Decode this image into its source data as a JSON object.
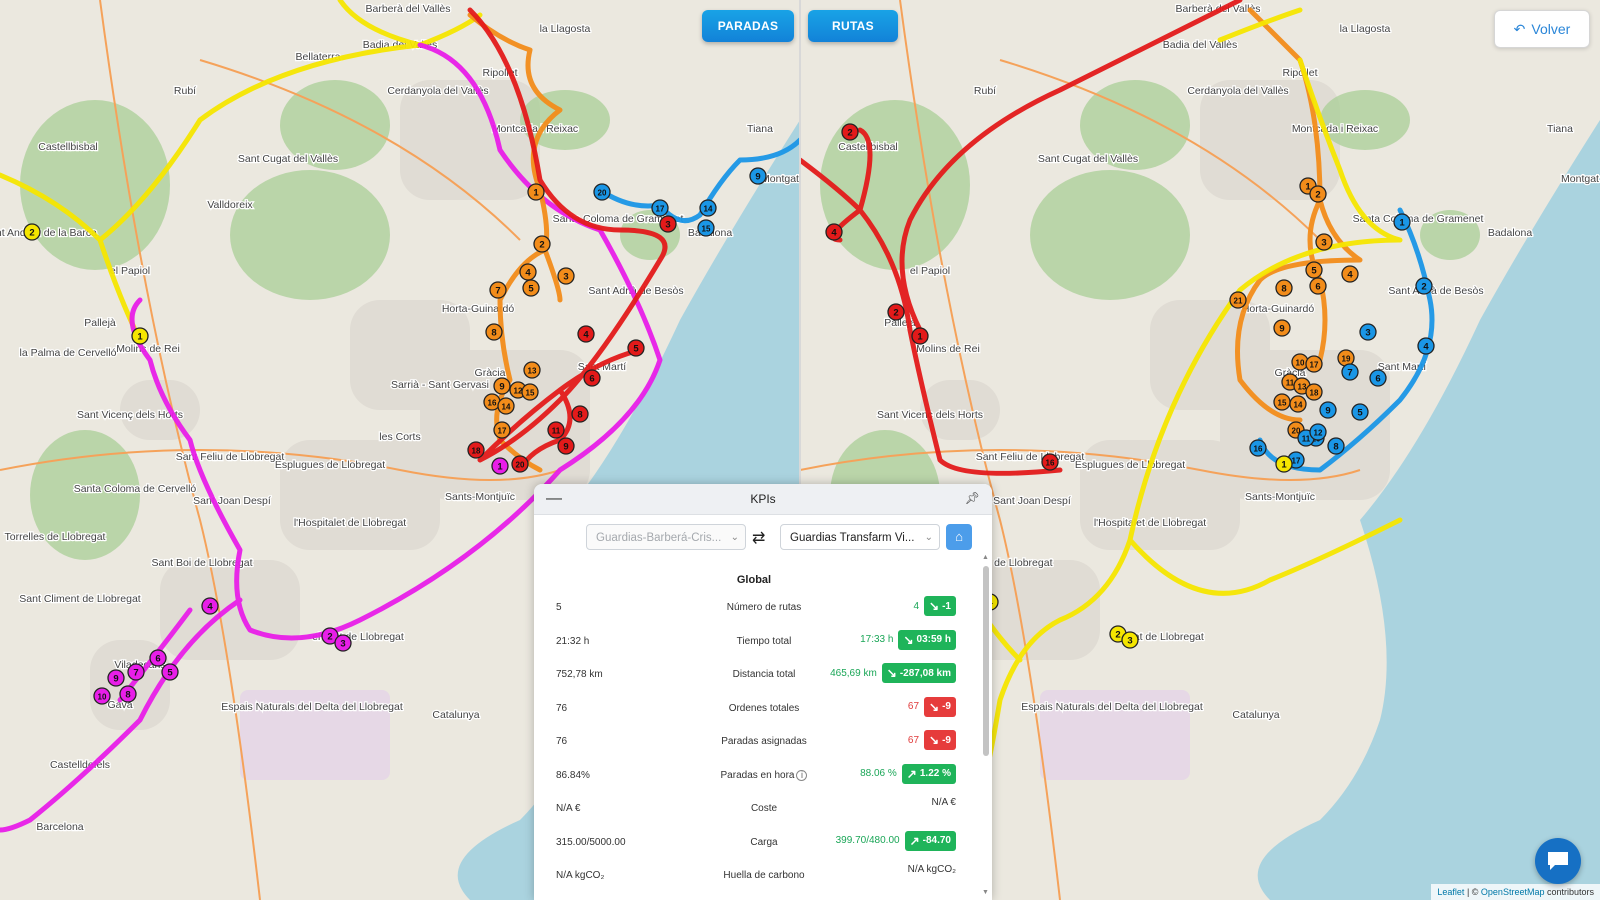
{
  "buttons": {
    "paradas": "PARADAS",
    "rutas": "RUTAS",
    "volver": "Volver",
    "volver_icon": "undo-icon"
  },
  "map_labels_left": [
    "Barberà del Vallès",
    "Badia del Vallès",
    "la Llagosta",
    "Ripollet",
    "Bellaterra",
    "Rubí",
    "Cerdanyola del Vallès",
    "Montcada i Reixac",
    "Castellbisbal",
    "Sant Cugat del Vallès",
    "Tiana",
    "Santa Coloma de Gramenet",
    "Badalona",
    "Montgat",
    "Sant Andreu de la Barca",
    "el Papiol",
    "Valldoreix",
    "Sant Adrià de Besòs",
    "Horta-Guinardó",
    "Pallejà",
    "Molins de Rei",
    "la Palma de Cervelló",
    "Gràcia",
    "Sant Martí",
    "Sarrià - Sant Gervasi",
    "Sant Vicenç dels Horts",
    "les Corts",
    "Esplugues de Llobregat",
    "Sant Feliu de Llobregat",
    "Santa Coloma de Cervelló",
    "Sant Joan Despí",
    "Sants-Montjuïc",
    "l'Hospitalet de Llobregat",
    "Torrelles de Llobregat",
    "Sant Boi de Llobregat",
    "Sant Climent de Llobregat",
    "el Prat de Llobregat",
    "Viladecans",
    "Gavà",
    "Castelldefels",
    "Espais Naturals del Delta del Llobregat",
    "Catalunya",
    "Barcelona"
  ],
  "map_labels_right": [
    "Barberà del Vallès",
    "Badia del Vallès",
    "la Llagosta",
    "Ripollet",
    "Rubí",
    "Cerdanyola del Vallès",
    "Montcada i Reixac",
    "Castellbisbal",
    "Sant Cugat del Vallès",
    "Tiana",
    "Santa Coloma de Gramenet",
    "Badalona",
    "Montgat",
    "el Papiol",
    "Pallejà",
    "Molins de Rei",
    "Sant Adrià de Besòs",
    "Horta-Guinardó",
    "Gràcia",
    "Sant Martí",
    "Sant Vicenç dels Horts",
    "Esplugues de Llobregat",
    "Sant Feliu de Llobregat",
    "Sant Joan Despí",
    "Sants-Montjuïc",
    "l'Hospitalet de Llobregat",
    "Sant Boi de Llobregat",
    "el Prat de Llobregat",
    "Espais Naturals del Delta del Llobregat",
    "Catalunya"
  ],
  "route_colors": {
    "yellow": "#f5e600",
    "magenta": "#e81ee8",
    "orange": "#f28c1a",
    "red": "#e31a1a",
    "blue": "#1a96e6"
  },
  "markers_left": [
    {
      "n": "2",
      "c": "yellow"
    },
    {
      "n": "1",
      "c": "yellow"
    },
    {
      "n": "4",
      "c": "magenta"
    },
    {
      "n": "2",
      "c": "magenta"
    },
    {
      "n": "3",
      "c": "magenta"
    },
    {
      "n": "5",
      "c": "magenta"
    },
    {
      "n": "6",
      "c": "magenta"
    },
    {
      "n": "7",
      "c": "magenta"
    },
    {
      "n": "9",
      "c": "magenta"
    },
    {
      "n": "10",
      "c": "magenta"
    },
    {
      "n": "8",
      "c": "magenta"
    },
    {
      "n": "1",
      "c": "magenta"
    },
    {
      "n": "1",
      "c": "orange"
    },
    {
      "n": "2",
      "c": "orange"
    },
    {
      "n": "3",
      "c": "orange"
    },
    {
      "n": "4",
      "c": "orange"
    },
    {
      "n": "5",
      "c": "orange"
    },
    {
      "n": "7",
      "c": "orange"
    },
    {
      "n": "8",
      "c": "orange"
    },
    {
      "n": "13",
      "c": "orange"
    },
    {
      "n": "9",
      "c": "orange"
    },
    {
      "n": "12",
      "c": "orange"
    },
    {
      "n": "15",
      "c": "orange"
    },
    {
      "n": "16",
      "c": "orange"
    },
    {
      "n": "14",
      "c": "orange"
    },
    {
      "n": "17",
      "c": "orange"
    },
    {
      "n": "3",
      "c": "red"
    },
    {
      "n": "4",
      "c": "red"
    },
    {
      "n": "5",
      "c": "red"
    },
    {
      "n": "6",
      "c": "red"
    },
    {
      "n": "8",
      "c": "red"
    },
    {
      "n": "18",
      "c": "red"
    },
    {
      "n": "20",
      "c": "red"
    },
    {
      "n": "9",
      "c": "red"
    },
    {
      "n": "11",
      "c": "red"
    },
    {
      "n": "20",
      "c": "blue"
    },
    {
      "n": "17",
      "c": "blue"
    },
    {
      "n": "14",
      "c": "blue"
    },
    {
      "n": "15",
      "c": "blue"
    },
    {
      "n": "9",
      "c": "blue"
    }
  ],
  "markers_right": [
    {
      "n": "2",
      "c": "red"
    },
    {
      "n": "4",
      "c": "red"
    },
    {
      "n": "2",
      "c": "red"
    },
    {
      "n": "1",
      "c": "red"
    },
    {
      "n": "16",
      "c": "red"
    },
    {
      "n": "1",
      "c": "orange"
    },
    {
      "n": "2",
      "c": "orange"
    },
    {
      "n": "3",
      "c": "orange"
    },
    {
      "n": "4",
      "c": "orange"
    },
    {
      "n": "5",
      "c": "orange"
    },
    {
      "n": "6",
      "c": "orange"
    },
    {
      "n": "8",
      "c": "orange"
    },
    {
      "n": "9",
      "c": "orange"
    },
    {
      "n": "21",
      "c": "orange"
    },
    {
      "n": "10",
      "c": "orange"
    },
    {
      "n": "17",
      "c": "orange"
    },
    {
      "n": "11",
      "c": "orange"
    },
    {
      "n": "13",
      "c": "orange"
    },
    {
      "n": "18",
      "c": "orange"
    },
    {
      "n": "15",
      "c": "orange"
    },
    {
      "n": "14",
      "c": "orange"
    },
    {
      "n": "20",
      "c": "orange"
    },
    {
      "n": "19",
      "c": "orange"
    },
    {
      "n": "1",
      "c": "blue"
    },
    {
      "n": "2",
      "c": "blue"
    },
    {
      "n": "3",
      "c": "blue"
    },
    {
      "n": "4",
      "c": "blue"
    },
    {
      "n": "5",
      "c": "blue"
    },
    {
      "n": "6",
      "c": "blue"
    },
    {
      "n": "7",
      "c": "blue"
    },
    {
      "n": "8",
      "c": "blue"
    },
    {
      "n": "9",
      "c": "blue"
    },
    {
      "n": "10",
      "c": "blue"
    },
    {
      "n": "11",
      "c": "blue"
    },
    {
      "n": "12",
      "c": "blue"
    },
    {
      "n": "16",
      "c": "blue"
    },
    {
      "n": "17",
      "c": "blue"
    },
    {
      "n": "4",
      "c": "yellow"
    },
    {
      "n": "2",
      "c": "yellow"
    },
    {
      "n": "3",
      "c": "yellow"
    },
    {
      "n": "1",
      "c": "yellow"
    }
  ],
  "kpi": {
    "title": "KPIs",
    "minimize_icon": "minus-icon",
    "pin_icon": "pin-icon",
    "select_a": "Guardias-Barberá-Cris...",
    "select_b": "Guardias Transfarm Vi...",
    "section": "Global",
    "rows": [
      {
        "left": "5",
        "label": "Número de rutas",
        "value": "4",
        "value_color": "green",
        "delta": "-1",
        "dir": "down",
        "badge": "green"
      },
      {
        "left": "21:32 h",
        "label": "Tiempo total",
        "value": "17:33 h",
        "value_color": "green",
        "delta": "03:59 h",
        "dir": "down",
        "badge": "green"
      },
      {
        "left": "752,78 km",
        "label": "Distancia total",
        "value": "465,69 km",
        "value_color": "green",
        "delta": "-287,08 km",
        "dir": "down",
        "badge": "green"
      },
      {
        "left": "76",
        "label": "Ordenes totales",
        "value": "67",
        "value_color": "red",
        "delta": "-9",
        "dir": "down",
        "badge": "red"
      },
      {
        "left": "76",
        "label": "Paradas asignadas",
        "value": "67",
        "value_color": "red",
        "delta": "-9",
        "dir": "down",
        "badge": "red"
      },
      {
        "left": "86.84%",
        "label": "Paradas en hora",
        "value": "88.06 %",
        "value_color": "green",
        "delta": "1.22 %",
        "dir": "up",
        "badge": "green",
        "info": true
      },
      {
        "left": "N/A €",
        "label": "Coste",
        "value": "N/A €",
        "value_color": "plain",
        "delta": null
      },
      {
        "left": "315.00/5000.00",
        "label": "Carga",
        "value": "399.70/480.00",
        "value_color": "green",
        "delta": "-84.70",
        "dir": "up",
        "badge": "green"
      },
      {
        "left": "N/A kgCO₂",
        "label": "Huella de carbono",
        "value": "N/A kgCO₂",
        "value_color": "plain",
        "delta": null
      }
    ]
  },
  "attribution": {
    "leaflet": "Leaflet",
    "sep": " | © ",
    "osm": "OpenStreetMap",
    "rest": " contributors"
  }
}
